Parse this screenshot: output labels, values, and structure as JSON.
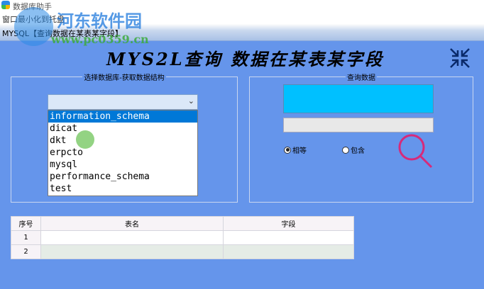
{
  "window": {
    "app_title": "数据库助手",
    "menu": "窗口最小化到托盘",
    "caption": "MYSQL【查询数据在某表某字段】"
  },
  "watermark": {
    "name": "河东软件园",
    "url": "www.pc0359.cn"
  },
  "heading": "MYS2L查询 数据在某表某字段",
  "left_group": {
    "legend": "选择数据库-获取数据结构",
    "combo_value": "",
    "options": [
      "information_schema",
      "dicat",
      "dkt",
      "erpcto",
      "mysql",
      "performance_schema",
      "test"
    ],
    "selected_index": 0
  },
  "right_group": {
    "legend": "查询数据",
    "query_value": "",
    "radio_equal": "相等",
    "radio_contains": "包含",
    "selected": "相等"
  },
  "table": {
    "headers": [
      "序号",
      "表名",
      "字段"
    ],
    "rows": [
      [
        "1",
        "",
        ""
      ],
      [
        "2",
        "",
        ""
      ]
    ]
  },
  "colors": {
    "background": "#6595eb",
    "query_box": "#00c0ff",
    "search_icon": "#d62a7a"
  }
}
